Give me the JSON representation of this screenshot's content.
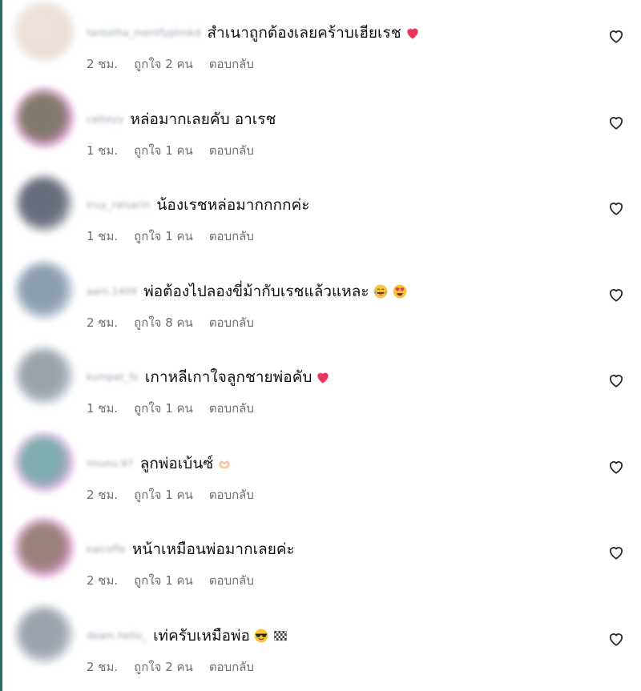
{
  "comments": [
    {
      "username": "tantotha_mentfyptmkd",
      "text": "สำเนาถูกต้องเลยคร้าบเฮียเรช",
      "emojis": [
        "red-heart"
      ],
      "time": "2 ชม.",
      "likes": "ถูกใจ 2 คน",
      "reply": "ตอบกลับ",
      "avatar_colors": [
        "#e8dcd4",
        "#d8c9be"
      ]
    },
    {
      "username": "catteyy",
      "text": "หล่อมากเลยคับ อาเรช",
      "emojis": [],
      "time": "1 ชม.",
      "likes": "ถูกใจ 1 คน",
      "reply": "ตอบกลับ",
      "avatar_colors": [
        "#6b6452",
        "#e25bc9"
      ]
    },
    {
      "username": "truy_ratsarin",
      "text": "น้องเรชหล่อมากกกกค่ะ",
      "emojis": [],
      "time": "1 ชม.",
      "likes": "ถูกใจ 1 คน",
      "reply": "ตอบกลับ",
      "avatar_colors": [
        "#4e5464",
        "#c7ccd4"
      ]
    },
    {
      "username": "aarn.1409",
      "text": "พ่อต้องไปลองขี่ม้ากับเรชแล้วแหละ",
      "emojis": [
        "tears-of-joy",
        "heart-eyes"
      ],
      "time": "2 ชม.",
      "likes": "ถูกใจ 8 คน",
      "reply": "ตอบกลับ",
      "avatar_colors": [
        "#7a8fa4",
        "#b8c7d6"
      ]
    },
    {
      "username": "kumpat_fo",
      "text": "เกาหลีเกาใจลูกชายพ่อคับ",
      "emojis": [
        "red-heart"
      ],
      "time": "1 ชม.",
      "likes": "ถูกใจ 1 คน",
      "reply": "ตอบกลับ",
      "avatar_colors": [
        "#8a949c",
        "#c3d0dc"
      ]
    },
    {
      "username": "nnunu.97",
      "text": "ลูกพ่อเบ้นซ์",
      "emojis": [
        "heart-hands"
      ],
      "time": "2 ชม.",
      "likes": "ถูกใจ 1 คน",
      "reply": "ตอบกลับ",
      "avatar_colors": [
        "#6aa0a0",
        "#e17ad4"
      ]
    },
    {
      "username": "kaicoffe",
      "text": "หน้าเหมือนพ่อมากเลยค่ะ",
      "emojis": [],
      "time": "2 ชม.",
      "likes": "ถูกใจ 1 คน",
      "reply": "ตอบกลับ",
      "avatar_colors": [
        "#8a6c64",
        "#e06bd0"
      ]
    },
    {
      "username": "deam.hello_",
      "text": "เท่ครับเหมือพ่อ",
      "emojis": [
        "sunglasses-face",
        "checkered-flag"
      ],
      "time": "2 ชม.",
      "likes": "ถูกใจ 2 คน",
      "reply": "ตอบกลับ",
      "avatar_colors": [
        "#8c949e",
        "#c6ccd4"
      ]
    }
  ],
  "colors": {
    "meta_text": "#6b7077",
    "like_icon": "#262626",
    "left_edge": "#2f6b62"
  }
}
